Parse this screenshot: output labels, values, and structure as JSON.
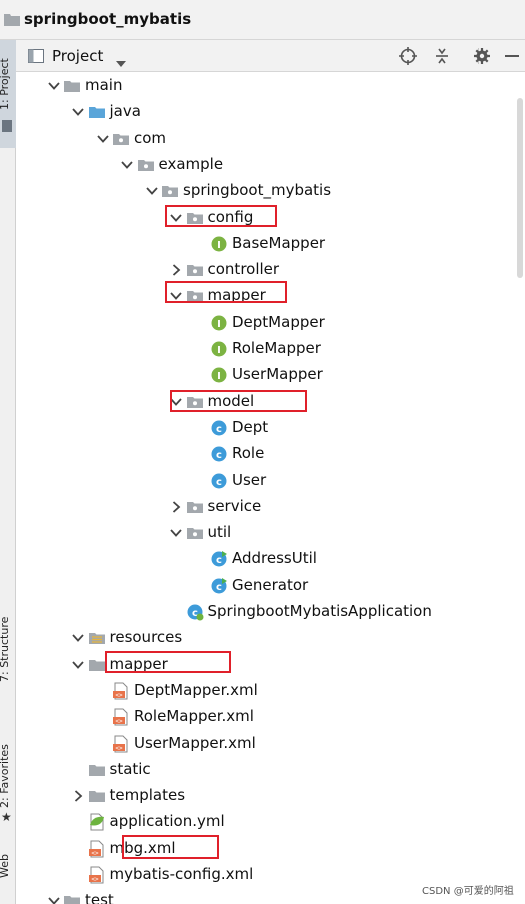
{
  "window": {
    "title": "springboot_mybatis"
  },
  "toolbar": {
    "project_label": "Project"
  },
  "sidebar": {
    "project_tab": "1: Project",
    "structure_tab": "7: Structure",
    "favorites_tab": "2: Favorites",
    "web_tab": "Web"
  },
  "tree": [
    {
      "label": "main",
      "arrow": "down",
      "icon": "folder-grey"
    },
    {
      "label": "java",
      "arrow": "down",
      "icon": "folder-blue"
    },
    {
      "label": "com",
      "arrow": "down",
      "icon": "package"
    },
    {
      "label": "example",
      "arrow": "down",
      "icon": "package"
    },
    {
      "label": "springboot_mybatis",
      "arrow": "down",
      "icon": "package"
    },
    {
      "label": "config",
      "arrow": "down",
      "icon": "package"
    },
    {
      "label": "BaseMapper",
      "arrow": "",
      "icon": "interface"
    },
    {
      "label": "controller",
      "arrow": "right",
      "icon": "package"
    },
    {
      "label": "mapper",
      "arrow": "down",
      "icon": "package"
    },
    {
      "label": "DeptMapper",
      "arrow": "",
      "icon": "interface"
    },
    {
      "label": "RoleMapper",
      "arrow": "",
      "icon": "interface"
    },
    {
      "label": "UserMapper",
      "arrow": "",
      "icon": "interface"
    },
    {
      "label": "model",
      "arrow": "down",
      "icon": "package"
    },
    {
      "label": "Dept",
      "arrow": "",
      "icon": "class"
    },
    {
      "label": "Role",
      "arrow": "",
      "icon": "class"
    },
    {
      "label": "User",
      "arrow": "",
      "icon": "class"
    },
    {
      "label": "service",
      "arrow": "right",
      "icon": "package"
    },
    {
      "label": "util",
      "arrow": "down",
      "icon": "package"
    },
    {
      "label": "AddressUtil",
      "arrow": "",
      "icon": "class-runnable"
    },
    {
      "label": "Generator",
      "arrow": "",
      "icon": "class-runnable"
    },
    {
      "label": "SpringbootMybatisApplication",
      "arrow": "",
      "icon": "spring-app"
    },
    {
      "label": "resources",
      "arrow": "down",
      "icon": "folder-resources"
    },
    {
      "label": "mapper",
      "arrow": "down",
      "icon": "folder-grey"
    },
    {
      "label": "DeptMapper.xml",
      "arrow": "",
      "icon": "xml"
    },
    {
      "label": "RoleMapper.xml",
      "arrow": "",
      "icon": "xml"
    },
    {
      "label": "UserMapper.xml",
      "arrow": "",
      "icon": "xml"
    },
    {
      "label": "static",
      "arrow": "",
      "icon": "folder-grey"
    },
    {
      "label": "templates",
      "arrow": "right",
      "icon": "folder-grey"
    },
    {
      "label": "application.yml",
      "arrow": "",
      "icon": "yml"
    },
    {
      "label": "mbg.xml",
      "arrow": "",
      "icon": "xml"
    },
    {
      "label": "mybatis-config.xml",
      "arrow": "",
      "icon": "xml"
    },
    {
      "label": "test",
      "arrow": "down",
      "icon": "folder-grey"
    }
  ],
  "watermark": "CSDN @可爱的阿祖",
  "colors": {
    "highlight": "#e0202a",
    "interface_icon": "#7cb342",
    "class_icon": "#3d9bd9",
    "folder_blue": "#5aa5d9",
    "folder_grey": "#a3a8ad",
    "xml_icon": "#e8734a"
  }
}
